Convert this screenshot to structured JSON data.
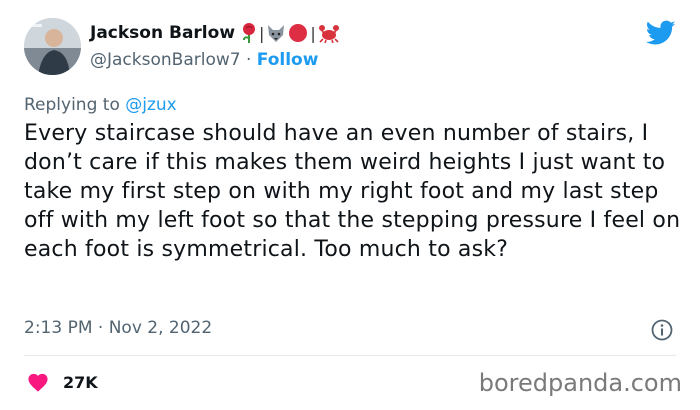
{
  "author": {
    "display_name": "Jackson Barlow",
    "name_decorations": [
      "rose-emoji",
      "wolf-emoji",
      "red-circle-emoji",
      "crab-emoji"
    ],
    "name_separator": "|",
    "handle": "@JacksonBarlow7",
    "handle_separator": "·",
    "follow_label": "Follow"
  },
  "reply": {
    "prefix": "Replying to",
    "mention": "@jzux"
  },
  "tweet": {
    "text": "Every staircase should have an even number of stairs, I don’t care if this makes them weird heights I just want to take my first step on with my right foot and my last step off with my left foot so that the stepping pressure I feel on each foot is symmetrical. Too much to ask?",
    "timestamp": "2:13 PM · Nov 2, 2022"
  },
  "engagement": {
    "likes": "27K"
  },
  "watermark": "boredpanda.com",
  "colors": {
    "twitter_blue": "#1d9bf0",
    "heart_pink": "#f91880",
    "text_primary": "#0f1419",
    "text_secondary": "#536471"
  },
  "icons": [
    "twitter-bird-icon",
    "info-icon",
    "heart-icon"
  ]
}
